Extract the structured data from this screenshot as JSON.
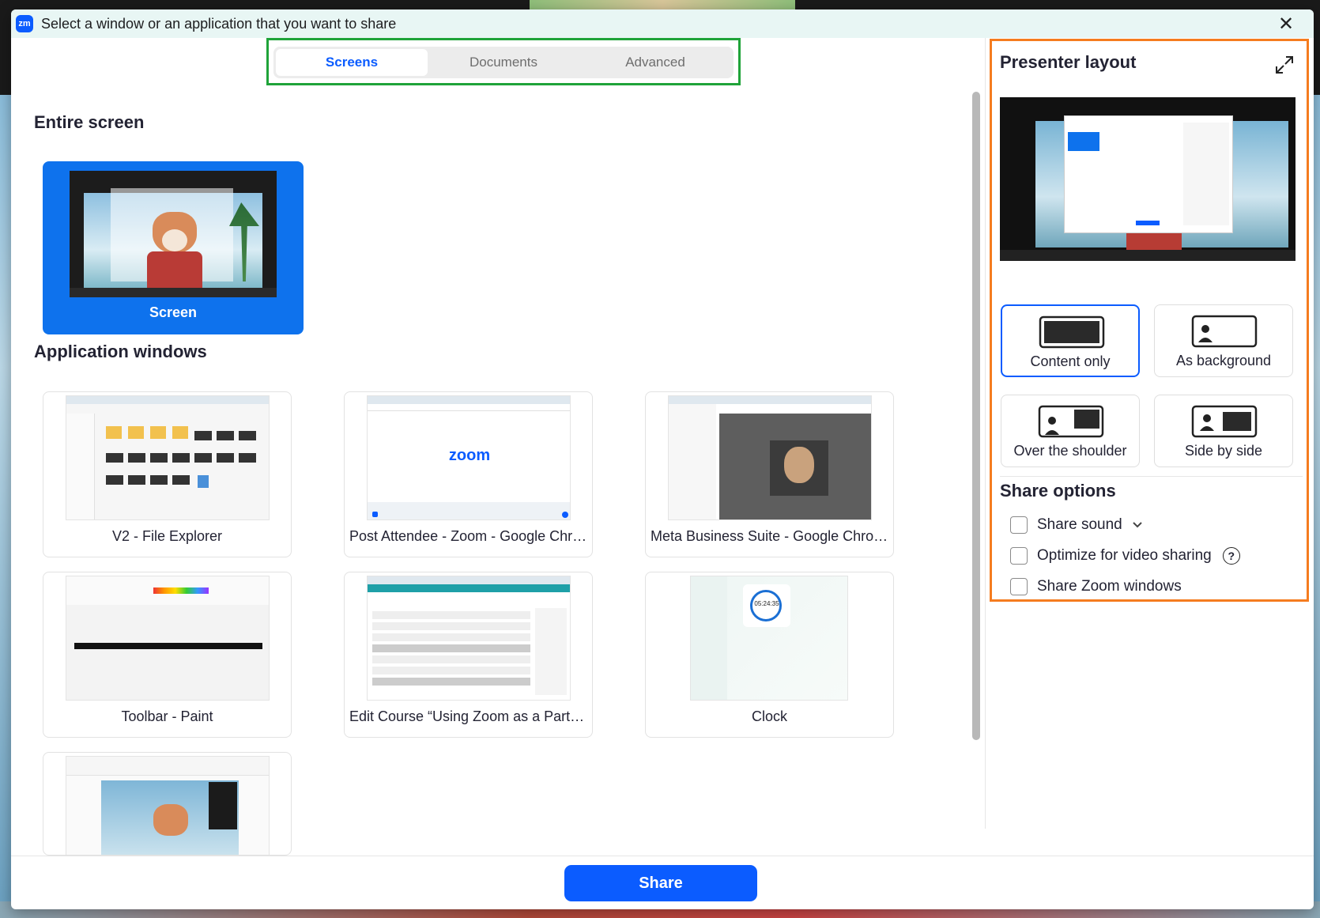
{
  "window": {
    "title": "Select a window or an application that you want to share",
    "logo_text": "zm",
    "close_glyph": "✕"
  },
  "tabs": [
    {
      "label": "Screens",
      "active": true
    },
    {
      "label": "Documents",
      "active": false
    },
    {
      "label": "Advanced",
      "active": false
    }
  ],
  "entire_screen": {
    "title": "Entire screen",
    "tile_label": "Screen"
  },
  "application_windows": {
    "title": "Application windows",
    "items": [
      {
        "label": "V2 - File Explorer"
      },
      {
        "label": "Post Attendee - Zoom - Google Chrome",
        "thumb_text": "zoom"
      },
      {
        "label": "Meta Business Suite - Google Chrome"
      },
      {
        "label": "Toolbar - Paint"
      },
      {
        "label": "Edit Course “Using Zoom as a Participa..."
      },
      {
        "label": "Clock",
        "thumb_text": "05:24:35"
      }
    ]
  },
  "presenter_layout": {
    "title": "Presenter layout",
    "expand_icon": "expand-icon",
    "options": [
      {
        "label": "Content only",
        "selected": true
      },
      {
        "label": "As background",
        "selected": false
      },
      {
        "label": "Over the shoulder",
        "selected": false
      },
      {
        "label": "Side by side",
        "selected": false
      }
    ]
  },
  "share_options": {
    "title": "Share options",
    "items": [
      {
        "label": "Share sound",
        "checked": false
      },
      {
        "label": "Optimize for video sharing",
        "checked": false
      },
      {
        "label": "Share Zoom windows",
        "checked": false
      }
    ],
    "help_glyph": "?"
  },
  "footer": {
    "share_label": "Share"
  },
  "colors": {
    "accent": "#0b5cff",
    "tabs_highlight": "#1fa339",
    "panel_highlight": "#f57c1f"
  }
}
